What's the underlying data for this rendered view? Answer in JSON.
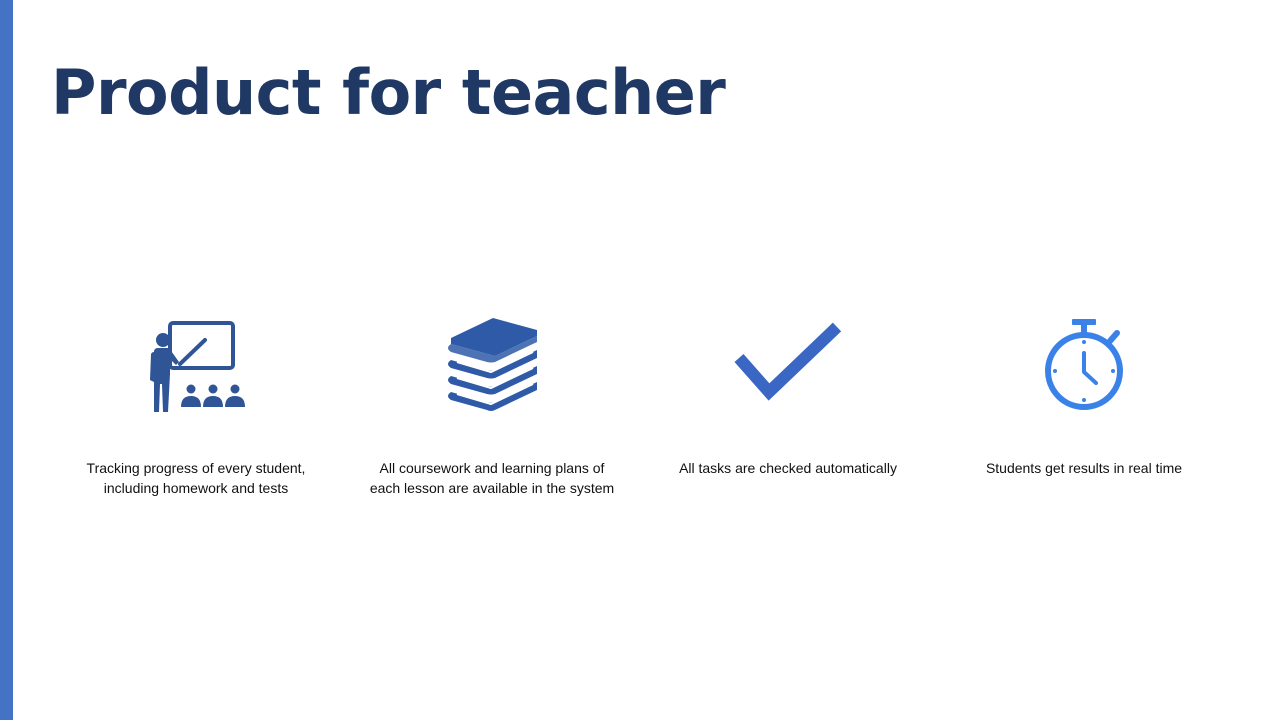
{
  "slide": {
    "title": "Product for teacher",
    "colors": {
      "accent_bar": "#4472c4",
      "title_text": "#1f3864",
      "icon_dark": "#2f5597",
      "icon_book": "#2f5aa8",
      "icon_check": "#3a66c4",
      "icon_stopwatch": "#3b82e8"
    }
  },
  "features": [
    {
      "icon": "teacher-presentation-icon",
      "caption_lines": [
        "Tracking progress of every student,",
        "including homework and tests"
      ]
    },
    {
      "icon": "books-stack-icon",
      "caption_lines": [
        "All coursework and learning plans of",
        "each lesson are available in the system"
      ]
    },
    {
      "icon": "checkmark-icon",
      "caption_lines": [
        "All tasks are checked automatically"
      ]
    },
    {
      "icon": "stopwatch-icon",
      "caption_lines": [
        "Students get results in real time"
      ]
    }
  ]
}
